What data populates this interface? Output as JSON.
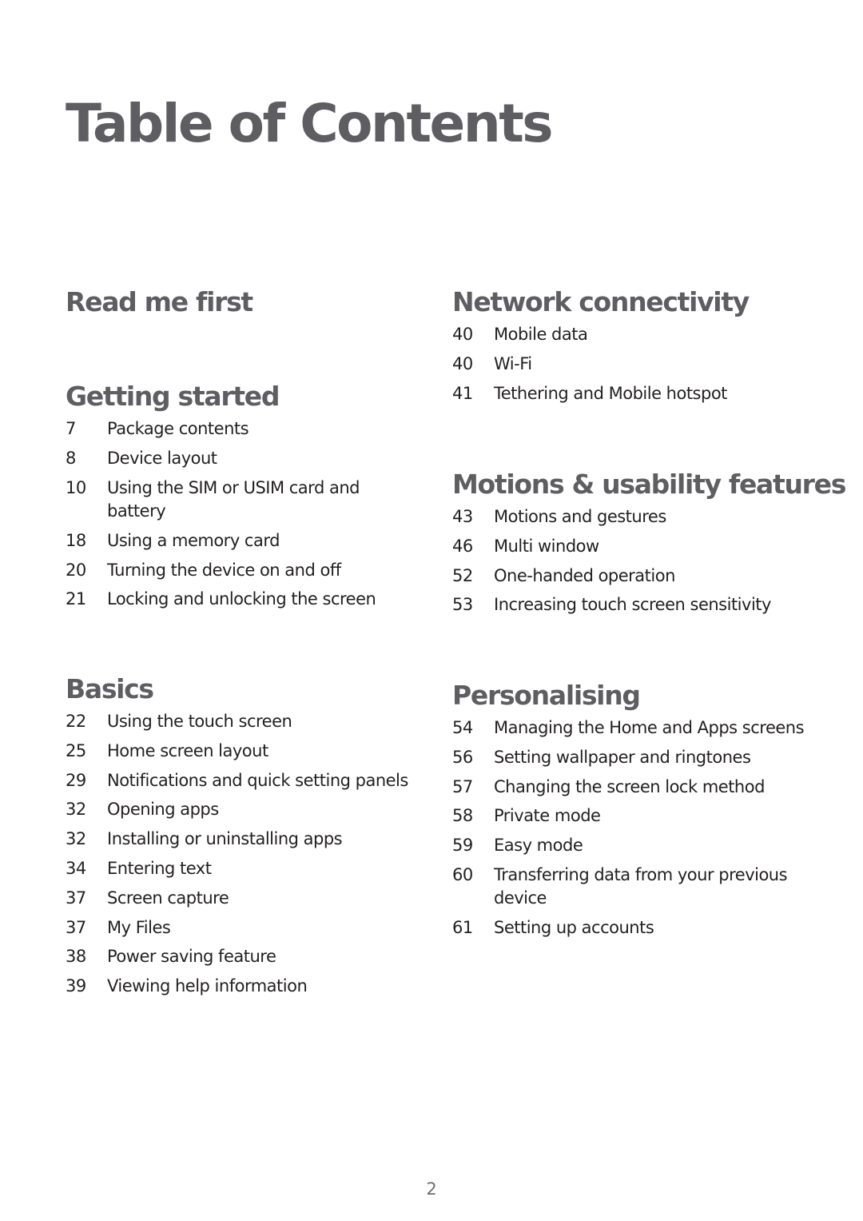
{
  "page_title": "Table of Contents",
  "footer_page_number": "2",
  "left_column": [
    {
      "title": "Read me first",
      "entries": []
    },
    {
      "title": "Getting started",
      "entries": [
        {
          "page": "7",
          "label": "Package contents"
        },
        {
          "page": "8",
          "label": "Device layout"
        },
        {
          "page": "10",
          "label": "Using the SIM or USIM card and battery"
        },
        {
          "page": "18",
          "label": "Using a memory card"
        },
        {
          "page": "20",
          "label": "Turning the device on and off"
        },
        {
          "page": "21",
          "label": "Locking and unlocking the screen"
        }
      ]
    },
    {
      "title": "Basics",
      "entries": [
        {
          "page": "22",
          "label": "Using the touch screen"
        },
        {
          "page": "25",
          "label": "Home screen layout"
        },
        {
          "page": "29",
          "label": "Notifications and quick setting panels"
        },
        {
          "page": "32",
          "label": "Opening apps"
        },
        {
          "page": "32",
          "label": "Installing or uninstalling apps"
        },
        {
          "page": "34",
          "label": "Entering text"
        },
        {
          "page": "37",
          "label": "Screen capture"
        },
        {
          "page": "37",
          "label": "My Files"
        },
        {
          "page": "38",
          "label": "Power saving feature"
        },
        {
          "page": "39",
          "label": "Viewing help information"
        }
      ]
    }
  ],
  "right_column": [
    {
      "title": "Network connectivity",
      "entries": [
        {
          "page": "40",
          "label": "Mobile data"
        },
        {
          "page": "40",
          "label": "Wi-Fi"
        },
        {
          "page": "41",
          "label": "Tethering and Mobile hotspot"
        }
      ]
    },
    {
      "title": "Motions & usability features",
      "entries": [
        {
          "page": "43",
          "label": "Motions and gestures"
        },
        {
          "page": "46",
          "label": "Multi window"
        },
        {
          "page": "52",
          "label": "One-handed operation"
        },
        {
          "page": "53",
          "label": "Increasing touch screen sensitivity"
        }
      ]
    },
    {
      "title": "Personalising",
      "entries": [
        {
          "page": "54",
          "label": "Managing the Home and Apps screens"
        },
        {
          "page": "56",
          "label": "Setting wallpaper and ringtones"
        },
        {
          "page": "57",
          "label": "Changing the screen lock method"
        },
        {
          "page": "58",
          "label": "Private mode"
        },
        {
          "page": "59",
          "label": "Easy mode"
        },
        {
          "page": "60",
          "label": "Transferring data from your previous device"
        },
        {
          "page": "61",
          "label": "Setting up accounts"
        }
      ]
    }
  ]
}
